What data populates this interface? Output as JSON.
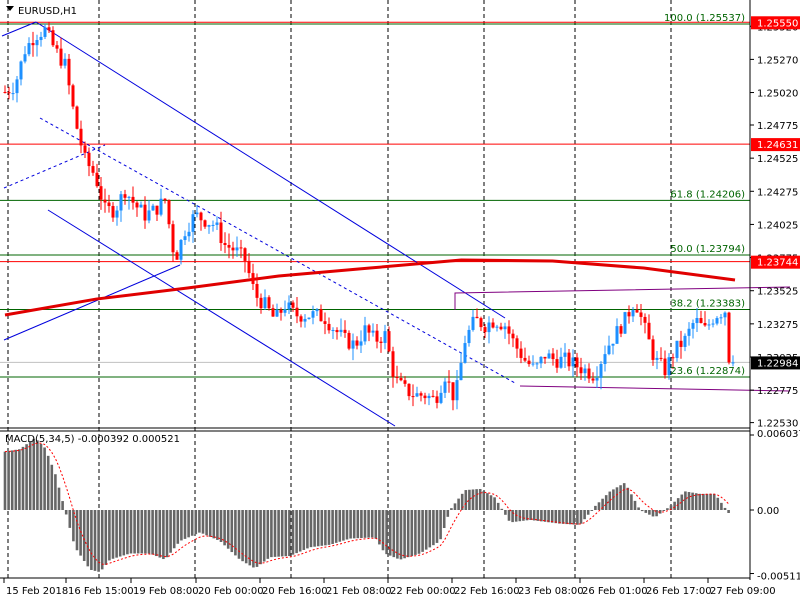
{
  "symbol_title": "EURUSD,H1",
  "colors": {
    "up": "#1e90ff",
    "down": "#ff0000",
    "fib": "#006400",
    "level": "#ff0000",
    "ma": "#e00000",
    "channel": "#0000dd",
    "range": "#800080",
    "macd_hist": "#666666",
    "macd_signal": "#ff0000"
  },
  "price_axis": {
    "ticks": [
      "1.25520",
      "1.25270",
      "1.25020",
      "1.24775",
      "1.24525",
      "1.24275",
      "1.24025",
      "1.23775",
      "1.23525",
      "1.23275",
      "1.23025",
      "1.22775",
      "1.22530"
    ],
    "tick_values": [
      1.2552,
      1.2527,
      1.2502,
      1.24775,
      1.24525,
      1.24275,
      1.24025,
      1.23775,
      1.23525,
      1.23275,
      1.23025,
      1.22775,
      1.2253
    ],
    "levels": [
      {
        "label": "1.25550",
        "value": 1.2555
      },
      {
        "label": "1.24631",
        "value": 1.24631
      },
      {
        "label": "1.23744",
        "value": 1.23744
      }
    ],
    "current_price": {
      "label": "1.22984",
      "value": 1.22984
    }
  },
  "fibonacci": [
    {
      "label": "100.0 (1.25537)",
      "value": 1.25537
    },
    {
      "label": "61.8 (1.24206)",
      "value": 1.24206
    },
    {
      "label": "50.0 (1.23794)",
      "value": 1.23794
    },
    {
      "label": "38.2 (1.23383)",
      "value": 1.23383
    },
    {
      "label": "23.6 (1.22874)",
      "value": 1.22874
    }
  ],
  "time_axis": [
    "15 Feb 2018",
    "16 Feb 15:00",
    "19 Feb 08:00",
    "20 Feb 00:00",
    "20 Feb 16:00",
    "21 Feb 08:00",
    "22 Feb 00:00",
    "22 Feb 16:00",
    "23 Feb 08:00",
    "26 Feb 01:00",
    "26 Feb 17:00",
    "27 Feb 09:00"
  ],
  "macd": {
    "label": "MACD(5,34,5) -0.000392 0.000521",
    "axis_ticks": [
      "0.006037",
      "0.00",
      "-0.005114"
    ],
    "axis_values": [
      0.006037,
      0,
      -0.005114
    ]
  },
  "chart_data": {
    "type": "candlestick",
    "title": "EURUSD,H1",
    "ylim": [
      1.2253,
      1.2565
    ],
    "close_path": [
      1.25024,
      1.25077,
      1.25341,
      1.25454,
      1.25492,
      1.25341,
      1.25228,
      1.24813,
      1.24511,
      1.24398,
      1.24134,
      1.24134,
      1.24285,
      1.24172,
      1.24096,
      1.24134,
      1.24209,
      1.23757,
      1.23983,
      1.24096,
      1.24058,
      1.24021,
      1.2387,
      1.23832,
      1.23757,
      1.23493,
      1.23417,
      1.23304,
      1.23417,
      1.23342,
      1.23342,
      1.23342,
      1.23319,
      1.23229,
      1.23153,
      1.23115,
      1.23229,
      1.23153,
      1.23191,
      1.22851,
      1.22776,
      1.22738,
      1.22738,
      1.22701,
      1.22889,
      1.22701,
      1.23153,
      1.23304,
      1.23266,
      1.23304,
      1.23266,
      1.23115,
      1.23002,
      1.22927,
      1.2304,
      1.23002,
      1.23002,
      1.22965,
      1.22927,
      1.22889,
      1.23078,
      1.23191,
      1.23304,
      1.23455,
      1.23229,
      1.23002,
      1.22927,
      1.23078,
      1.23153,
      1.23304,
      1.23229,
      1.23342,
      1.23379,
      1.23266,
      1.22984
    ],
    "macd_histogram_path": [
      0.0047,
      0.0049,
      0.0058,
      0.005,
      0.003,
      0,
      -0.003,
      -0.0048,
      -0.005,
      -0.004,
      -0.0035,
      -0.0035,
      -0.004,
      -0.0025,
      -0.0018,
      -0.0025,
      -0.004,
      -0.0047,
      -0.0038,
      -0.0037,
      -0.003,
      -0.0028,
      -0.0023,
      -0.0022,
      -0.0035,
      -0.004,
      -0.0035,
      -0.0025,
      0,
      0.0016,
      0.0017,
      0.001,
      -0.001,
      -0.0008,
      -0.0011,
      -0.0012,
      0.0003,
      0.0015,
      0.0022,
      0,
      -0.0006,
      0.0003,
      0.0015,
      0.0013,
      0.0013,
      -0.0004
    ],
    "moving_average_path": [
      1.23342,
      1.23447,
      1.2353,
      1.23621,
      1.23681,
      1.23742,
      1.23734,
      1.23681,
      1.23606
    ]
  }
}
